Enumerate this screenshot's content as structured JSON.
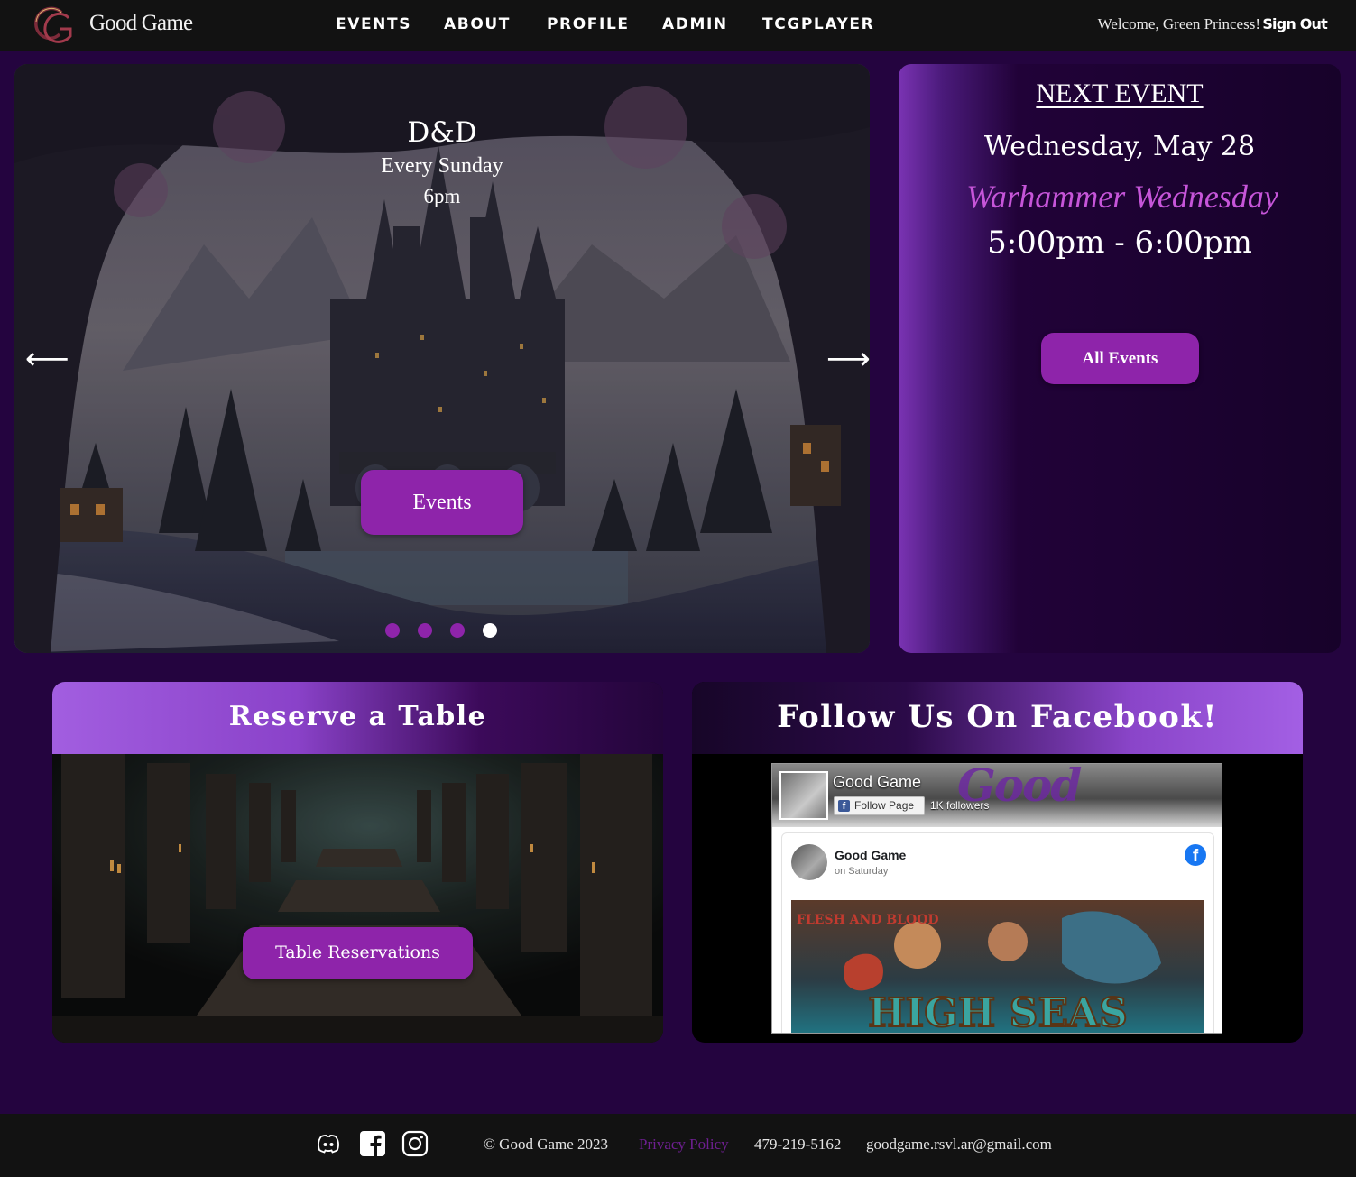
{
  "nav": {
    "brand": "Good Game",
    "links": [
      "EVENTS",
      "ABOUT",
      "PROFILE",
      "ADMIN",
      "TCGPLAYER"
    ],
    "welcome": "Welcome, Green Princess!",
    "sign_out": "Sign Out"
  },
  "carousel": {
    "title": "D&D",
    "subtitle": "Every Sunday",
    "time": "6pm",
    "button": "Events",
    "prev_icon": "arrow-left-icon",
    "next_icon": "arrow-right-icon",
    "slide_count": 4,
    "active_index": 3
  },
  "next_event": {
    "heading": "NEXT EVENT",
    "date": "Wednesday, May 28",
    "name": "Warhammer Wednesday",
    "time": "5:00pm - 6:00pm",
    "button": "All Events"
  },
  "reserve": {
    "title": "Reserve a Table",
    "button": "Table Reservations"
  },
  "facebook": {
    "title": "Follow Us On Facebook!",
    "page_name": "Good Game",
    "follow_button": "Follow Page",
    "followers": "1K followers",
    "post_author": "Good Game",
    "post_time": "on Saturday",
    "post_image_text": "HIGH SEAS",
    "post_image_corner": "FLESH AND BLOOD"
  },
  "footer": {
    "social_icons": [
      "discord-icon",
      "facebook-icon",
      "instagram-icon"
    ],
    "copyright": "© Good Game 2023",
    "privacy": "Privacy Policy",
    "phone": "479-219-5162",
    "email": "goodgame.rsvl.ar@gmail.com"
  },
  "colors": {
    "page_bg": "#24043f",
    "navbar_bg": "#121212",
    "accent": "#8e24aa",
    "event_name": "#c655d9",
    "privacy_link": "#6e1f91"
  }
}
